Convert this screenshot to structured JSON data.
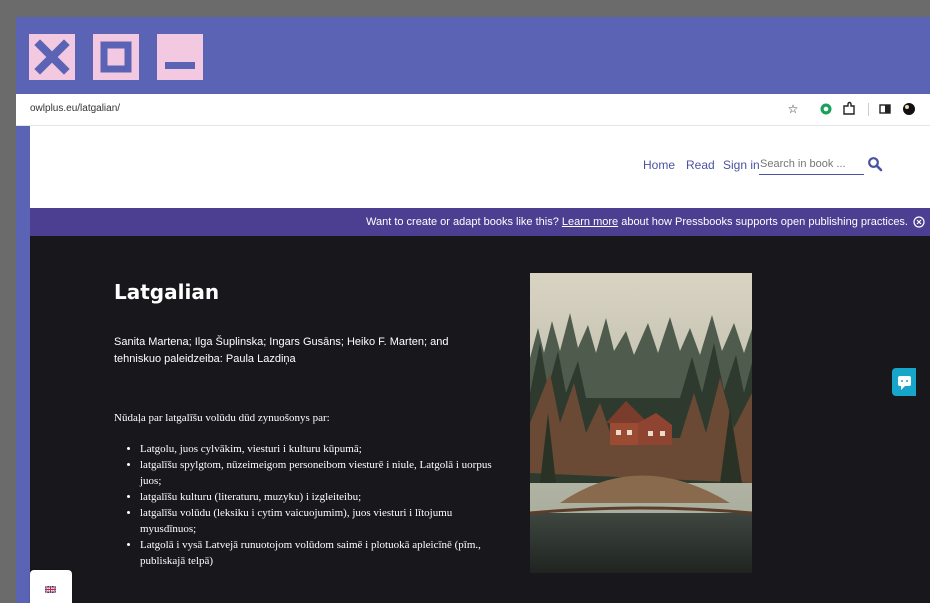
{
  "browser": {
    "url": "owlplus.eu/latgalian/"
  },
  "nav": {
    "home": "Home",
    "read": "Read",
    "sign_in": "Sign in",
    "search_placeholder": "Search in book ..."
  },
  "banner": {
    "prefix": "Want to create or adapt books like this?",
    "link": "Learn more",
    "suffix": "about how Pressbooks supports open publishing practices."
  },
  "book": {
    "title": "Latgalian",
    "authors": "Sanita Martena; Ilga Šuplinska; Ingars Gusāns; Heiko F. Marten; and tehniskuo paleidzeiba: Paula Lazdiņa",
    "intro": "Nūdaļa par latgalīšu volūdu dūd zynuošonys par:",
    "bullets": [
      "Latgolu, juos cylvākim, viesturi i kulturu kūpumā;",
      "latgalīšu spylgtom, nūzeimeigom personeibom viesturē i niule, Latgolā i uorpus juos;",
      "latgalīšu kulturu (literaturu, muzyku) i izgleiteibu;",
      "latgalīšu volūdu (leksiku i cytim vaicuojumim), juos viesturi i lītojumu myusdīnuos;",
      "Latgolā i vysā Latvejā runuotojom volūdom saimē i plotuokā apleicīnē (pīm., publiskajā telpā)"
    ]
  },
  "colors": {
    "window_frame": "#5b63b5",
    "window_buttons": "#f2c9e0",
    "banner": "#4c3f91",
    "hero": "#18171c",
    "nav_link": "#4a52a3",
    "side_tab": "#16a6c9"
  }
}
